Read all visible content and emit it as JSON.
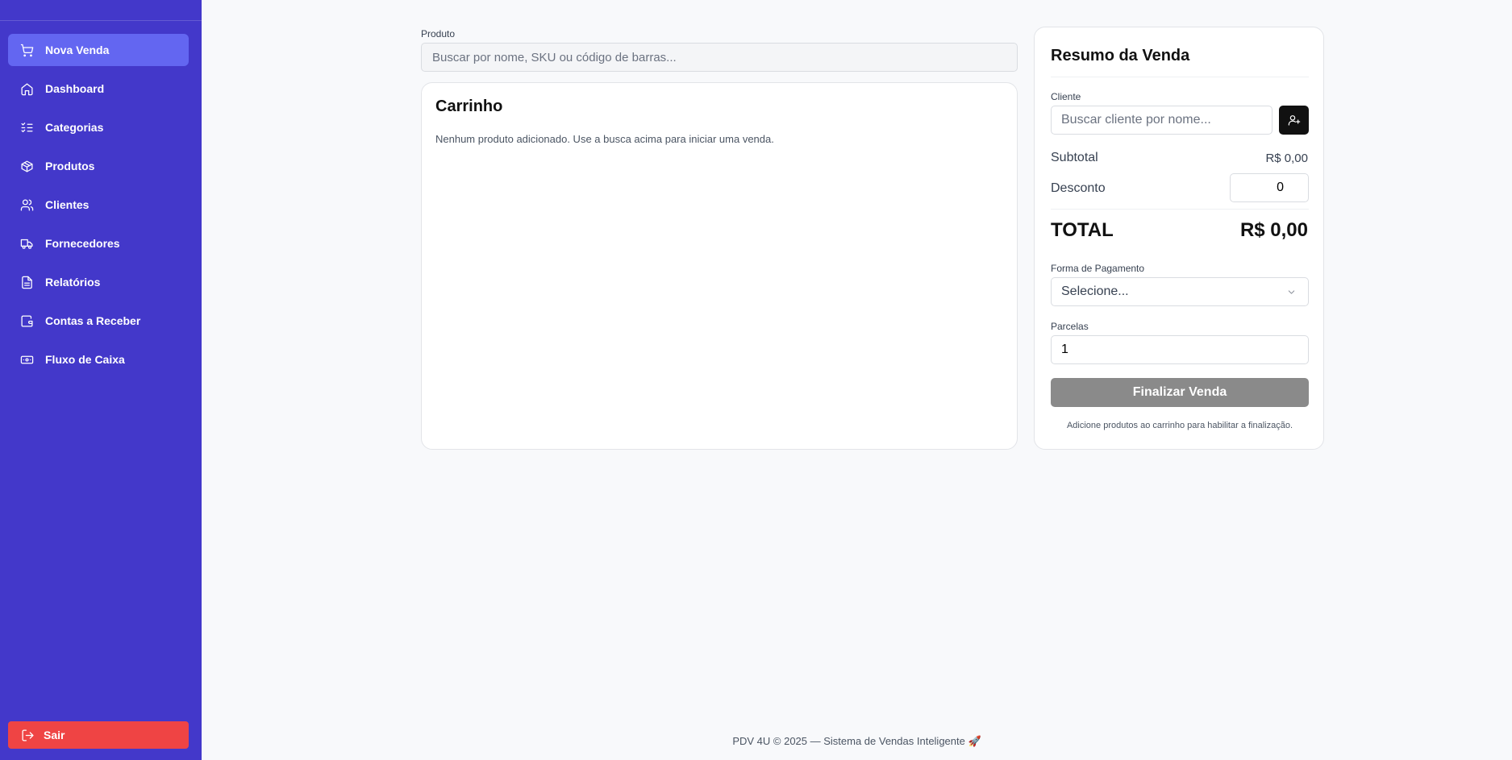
{
  "sidebar": {
    "items": [
      {
        "label": "Nova Venda",
        "icon": "cart-icon",
        "active": true
      },
      {
        "label": "Dashboard",
        "icon": "home-icon"
      },
      {
        "label": "Categorias",
        "icon": "list-checks-icon"
      },
      {
        "label": "Produtos",
        "icon": "package-icon"
      },
      {
        "label": "Clientes",
        "icon": "users-icon"
      },
      {
        "label": "Fornecedores",
        "icon": "truck-icon"
      },
      {
        "label": "Relatórios",
        "icon": "file-text-icon"
      },
      {
        "label": "Contas a Receber",
        "icon": "wallet-icon"
      },
      {
        "label": "Fluxo de Caixa",
        "icon": "banknote-icon"
      }
    ],
    "logout_label": "Sair",
    "colors": {
      "background": "#4338ca",
      "active": "#6366f1",
      "logout": "#ef4444"
    }
  },
  "product": {
    "label": "Produto",
    "placeholder": "Buscar por nome, SKU ou código de barras..."
  },
  "cart": {
    "title": "Carrinho",
    "empty_message": "Nenhum produto adicionado. Use a busca acima para iniciar uma venda."
  },
  "summary": {
    "title": "Resumo da Venda",
    "client_label": "Cliente",
    "client_placeholder": "Buscar cliente por nome...",
    "subtotal_label": "Subtotal",
    "subtotal_value": "R$ 0,00",
    "discount_label": "Desconto",
    "discount_value": "0",
    "total_label": "TOTAL",
    "total_value": "R$ 0,00",
    "payment_label": "Forma de Pagamento",
    "payment_selected": "Selecione...",
    "installments_label": "Parcelas",
    "installments_value": "1",
    "finalize_label": "Finalizar Venda",
    "finalize_hint": "Adicione produtos ao carrinho para habilitar a finalização."
  },
  "footer": {
    "text": "PDV 4U © 2025 — Sistema de Vendas Inteligente 🚀"
  }
}
